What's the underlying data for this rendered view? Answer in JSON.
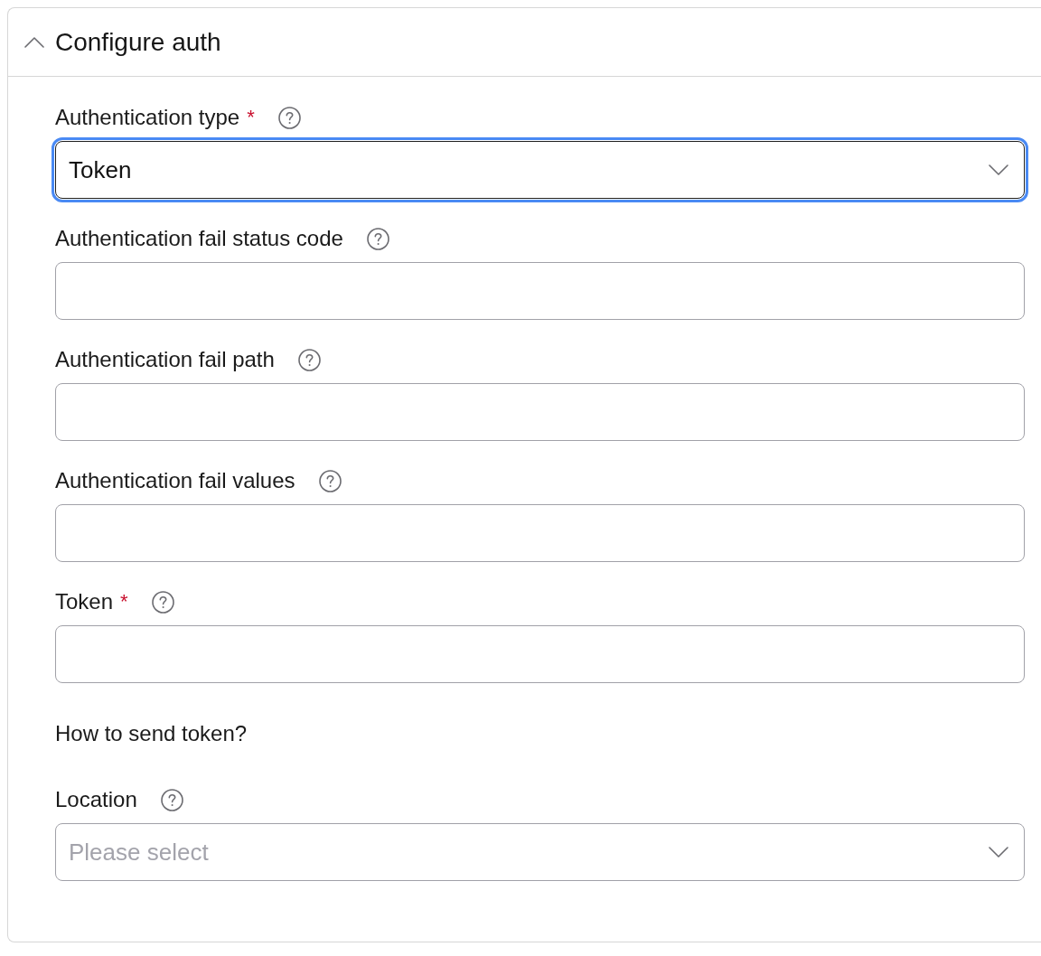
{
  "section": {
    "title": "Configure auth",
    "expanded": true
  },
  "fields": [
    {
      "kind": "select",
      "label": "Authentication type",
      "required_mark": "*",
      "value": "Token",
      "focused": true
    },
    {
      "kind": "text",
      "label": "Authentication fail status code",
      "focused": false
    },
    {
      "kind": "text",
      "label": "Authentication fail path",
      "focused": false
    },
    {
      "kind": "text",
      "label": "Authentication fail values",
      "focused": false
    },
    {
      "kind": "text",
      "label": "Token",
      "required_mark": "*",
      "focused": false
    },
    {
      "kind": "note",
      "text": "How to send token?"
    },
    {
      "kind": "select",
      "label": "Location",
      "placeholder": "Please select",
      "focused": false
    }
  ]
}
